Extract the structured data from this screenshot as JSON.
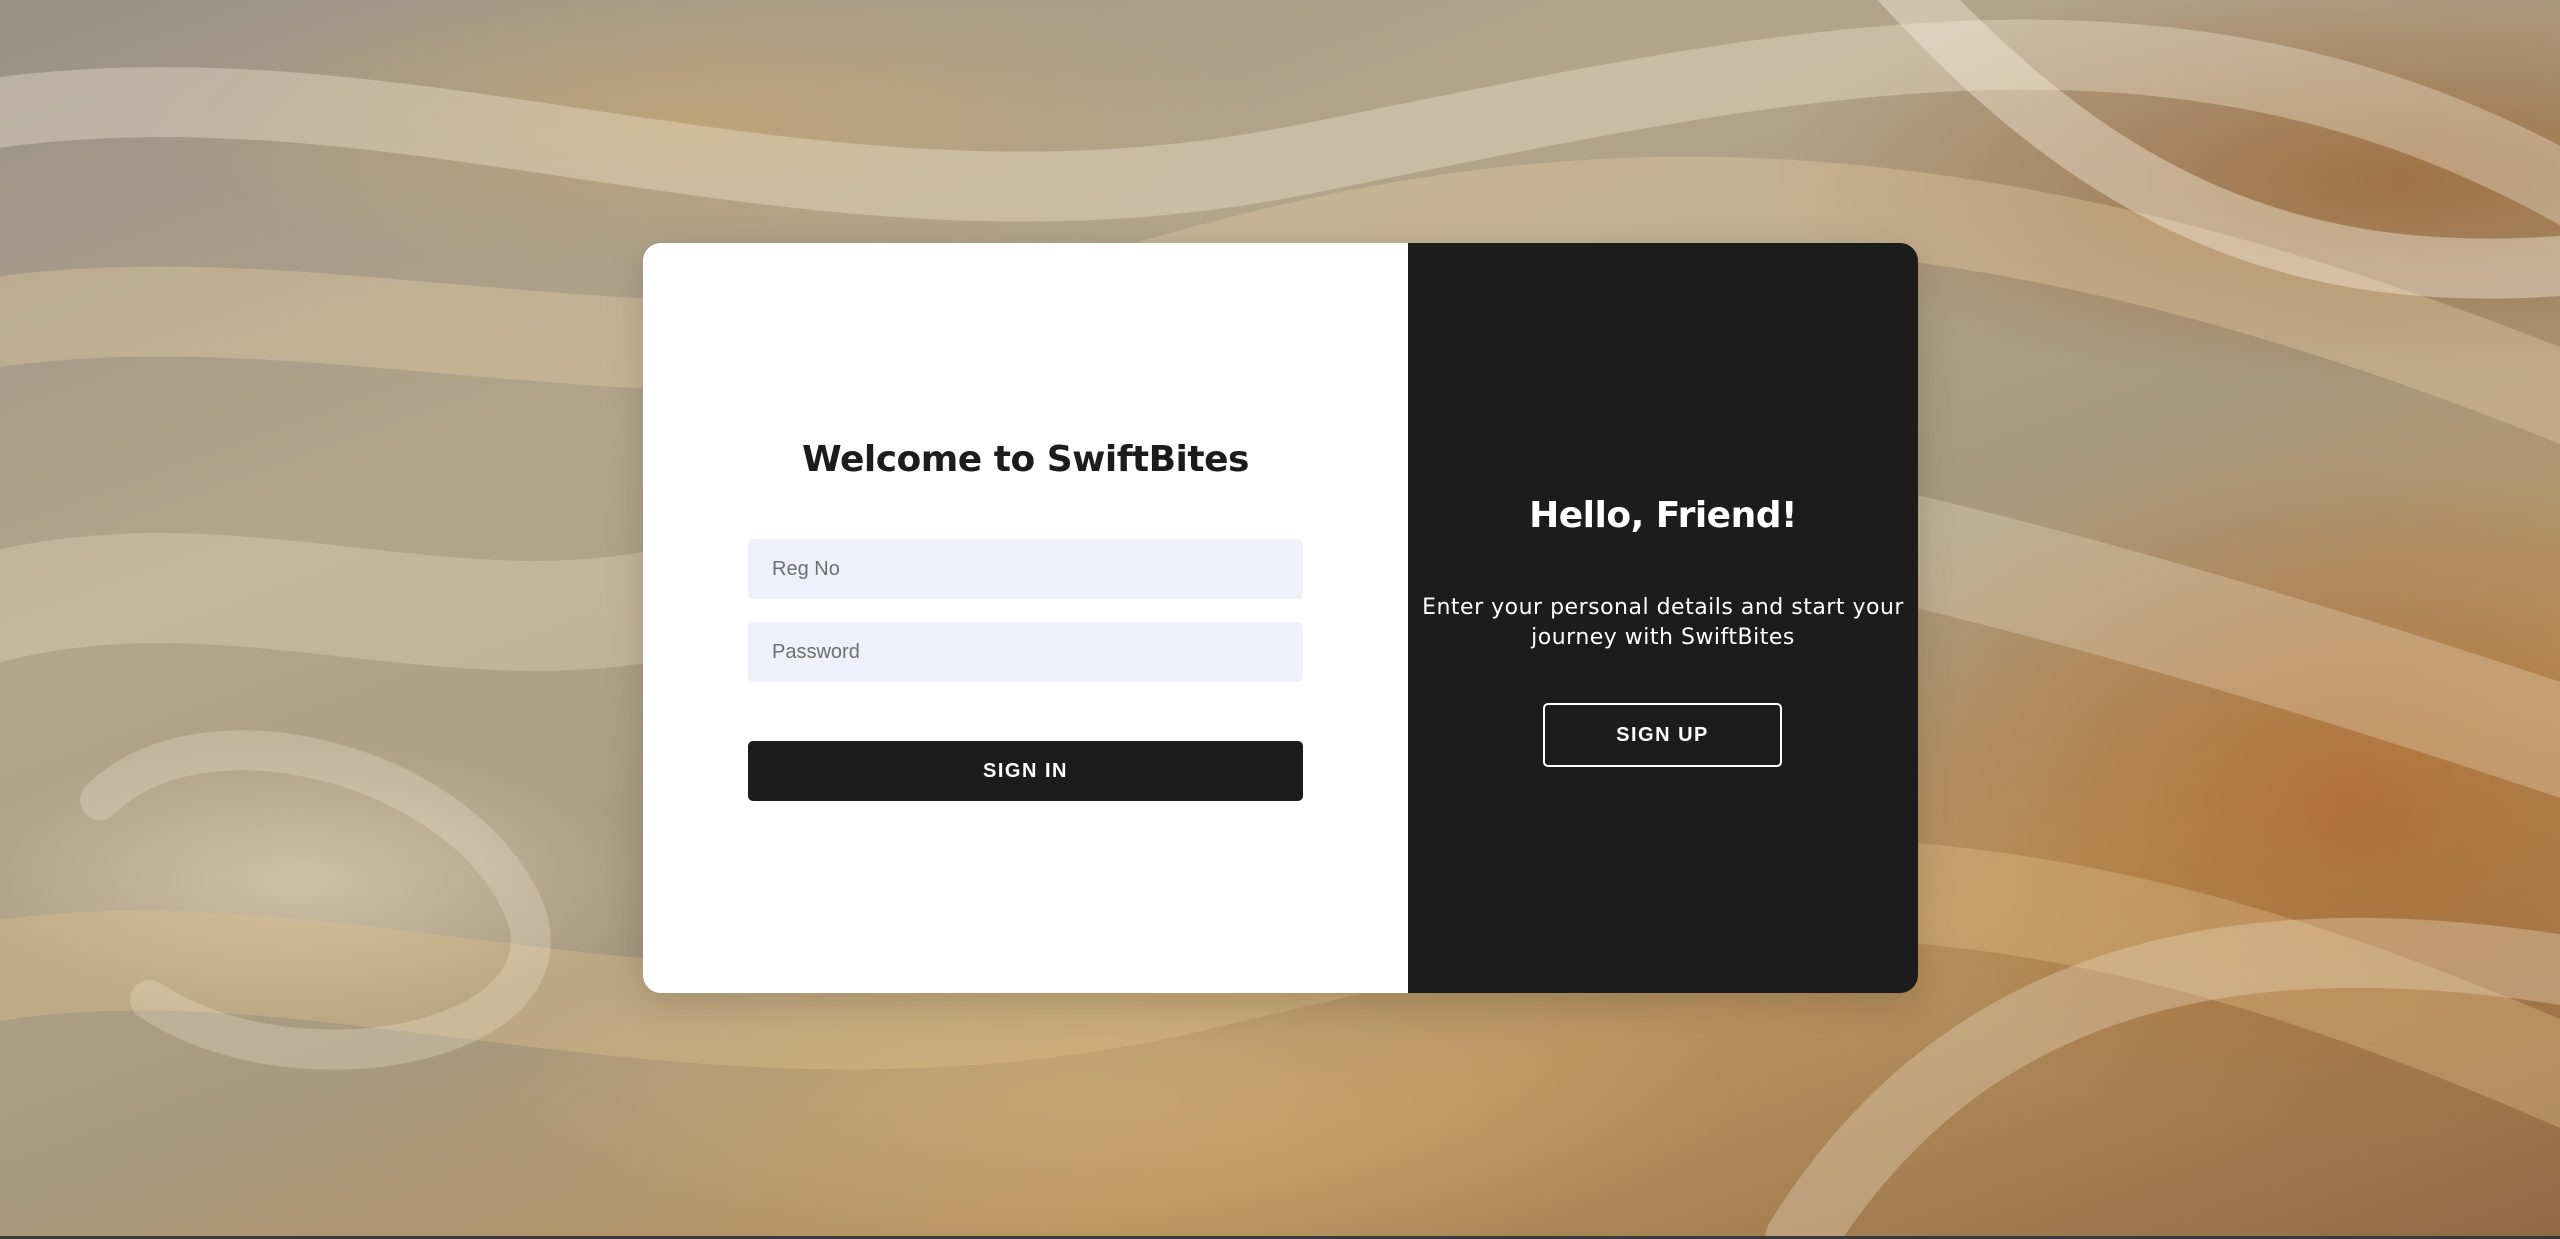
{
  "login": {
    "title": "Welcome to SwiftBites",
    "reg_no_placeholder": "Reg No",
    "password_placeholder": "Password",
    "sign_in_label": "SIGN IN"
  },
  "promo": {
    "title": "Hello, Friend!",
    "message": "Enter your personal details and start your journey with SwiftBites",
    "sign_up_label": "SIGN UP"
  },
  "colors": {
    "dark_panel": "#1c1c1c",
    "input_background": "#eff0fb",
    "card_background": "#ffffff"
  }
}
